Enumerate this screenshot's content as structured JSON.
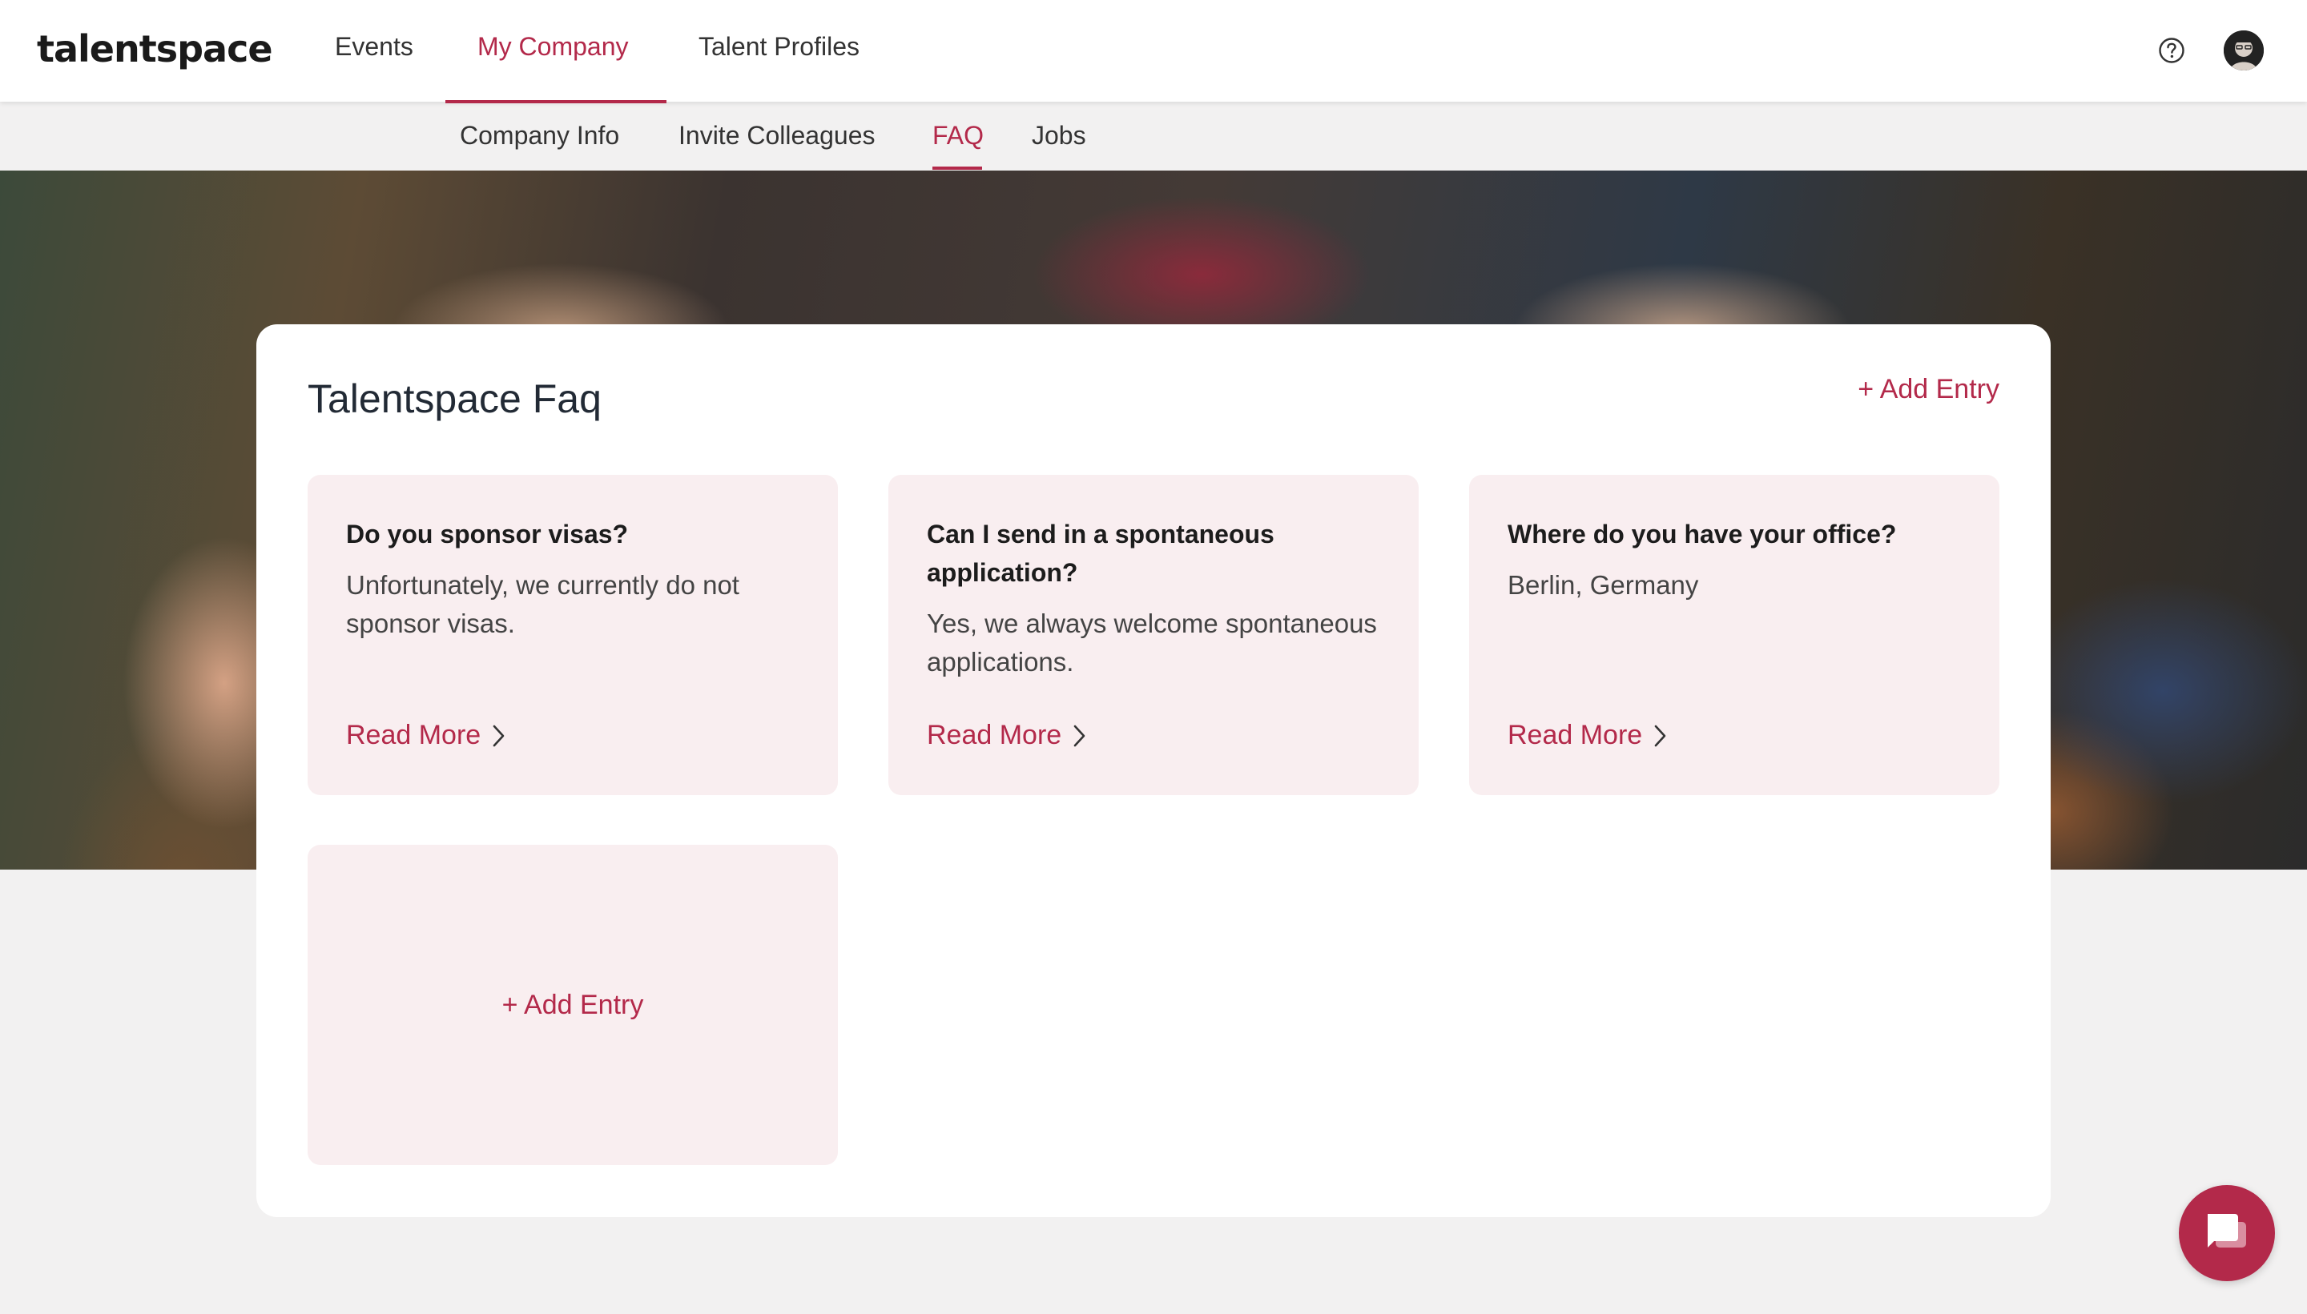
{
  "brand": {
    "logo": "talentspace"
  },
  "main_nav": {
    "items": [
      {
        "label": "Events",
        "active": false
      },
      {
        "label": "My Company",
        "active": true
      },
      {
        "label": "Talent Profiles",
        "active": false
      }
    ]
  },
  "header_icons": {
    "help": "help-circle-icon",
    "avatar": "user-avatar"
  },
  "sub_nav": {
    "items": [
      {
        "label": "Company Info",
        "active": false
      },
      {
        "label": "Invite Colleagues",
        "active": false
      },
      {
        "label": "FAQ",
        "active": true
      },
      {
        "label": "Jobs",
        "active": false
      }
    ]
  },
  "faq_section": {
    "title": "Talentspace Faq",
    "add_entry_label": "+ Add Entry",
    "entries": [
      {
        "question": "Do you sponsor visas?",
        "answer": "Unfortunately, we currently do not sponsor visas.",
        "read_more": "Read More"
      },
      {
        "question": "Can I send in a spontaneous application?",
        "answer": "Yes, we always welcome spontaneous applications.",
        "read_more": "Read More"
      },
      {
        "question": "Where do you have your office?",
        "answer": "Berlin, Germany",
        "read_more": "Read More"
      }
    ],
    "add_tile_label": "+ Add Entry"
  },
  "chat_widget": {
    "icon": "chat-bubble-icon"
  },
  "colors": {
    "accent": "#b3294a",
    "tile_bg": "#f9eef0",
    "page_bg": "#f2f1f1"
  }
}
